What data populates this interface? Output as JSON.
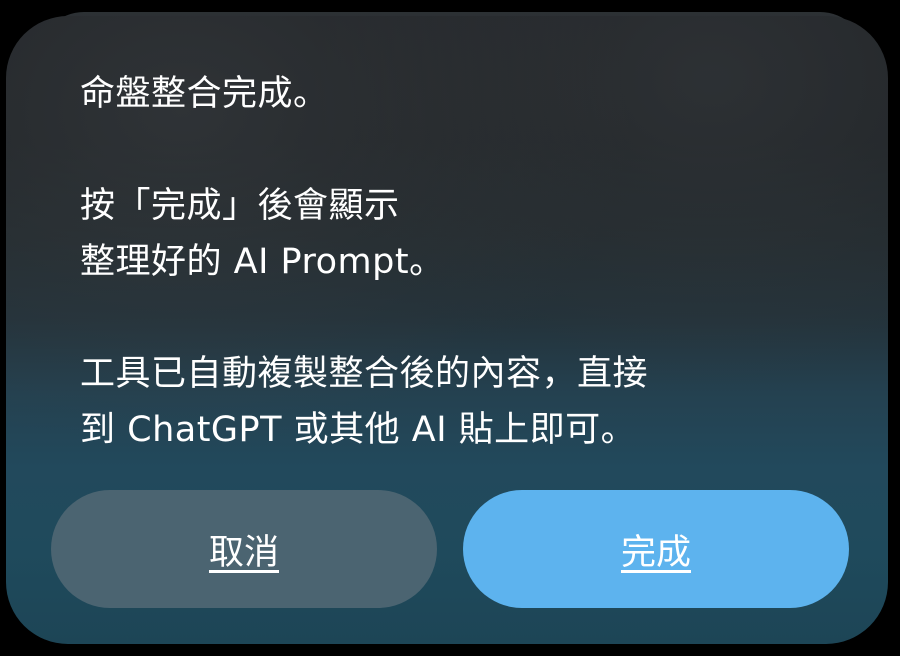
{
  "dialog": {
    "message_lines": [
      "命盤整合完成。",
      "",
      "按「完成」後會顯示",
      "整理好的 AI Prompt。",
      "",
      "工具已自動複製整合後的內容，直接",
      "到 ChatGPT 或其他 AI 貼上即可。"
    ],
    "cancel_label": "取消",
    "done_label": "完成"
  },
  "colors": {
    "cancel_button": "#4b6471",
    "done_button": "#5db3ee",
    "text": "#ffffff"
  }
}
